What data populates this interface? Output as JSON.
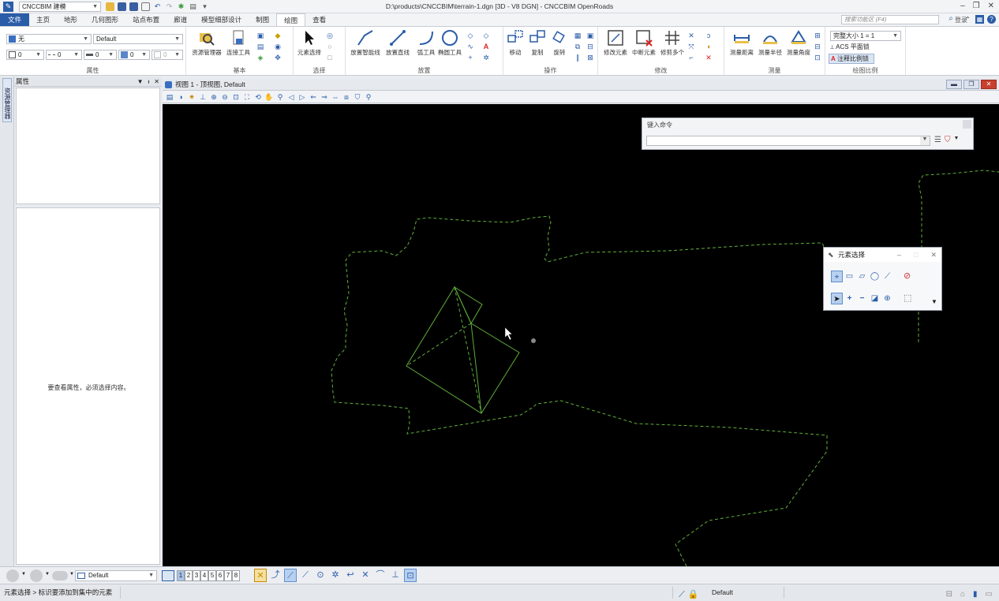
{
  "titlebar": {
    "workspace": "CNCCBIM 建模",
    "doc_title": "D:\\products\\CNCCBIM\\terrain-1.dgn [3D - V8 DGN] - CNCCBIM OpenRoads"
  },
  "ribbon_tabs": [
    "文件",
    "主页",
    "地形",
    "几何图形",
    "站点布置",
    "廊道",
    "模型细部设计",
    "制图",
    "绘图",
    "查看"
  ],
  "active_tab_index": 8,
  "search": {
    "placeholder": "搜索功能区 (F4)"
  },
  "login_label": "登录",
  "attributes_group": {
    "label": "属性",
    "level_value": "无",
    "style_value": "Default",
    "color_value": "0",
    "weight_value": "0",
    "linestyle_value": "0",
    "transparency_value": "0",
    "priority_value": "0"
  },
  "basic_group": {
    "label": "基本",
    "resource_manager": "资源管理器",
    "attach_tools": "连接工具"
  },
  "select_group": {
    "label": "选择",
    "element_selection": "元素选择"
  },
  "place_group": {
    "label": "放置",
    "smartline": "放置智能线",
    "place_line": "放置直线",
    "arc_tools": "弧工具",
    "ellipse_tools": "椭圆工具"
  },
  "operate_group": {
    "label": "操作",
    "move": "移动",
    "copy": "复制",
    "rotate": "旋转"
  },
  "modify_group": {
    "label": "修改",
    "modify_element": "修改元素",
    "break_element": "中断元素",
    "trim_multiple": "修剪多个"
  },
  "measure_group": {
    "label": "测量",
    "distance": "测量距离",
    "radius": "测量半径",
    "angle": "测量角度"
  },
  "drawing_scale_group": {
    "label": "绘图比例",
    "scale_value": "完整大小 1 = 1",
    "acs_plane": "ACS 平面锁",
    "annotation_scale": "注释比例锁"
  },
  "properties_panel": {
    "title": "属性",
    "side_tab": "资源管理器",
    "empty_message": "要查看属性，必须选择内容。"
  },
  "view": {
    "title": "视图 1 - 顶视图, Default"
  },
  "keyin": {
    "title": "键入命令",
    "value": ""
  },
  "element_selection_dialog": {
    "title": "元素选择"
  },
  "bottom_bar": {
    "level_value": "Default",
    "view_numbers": [
      "1",
      "2",
      "3",
      "4",
      "5",
      "6",
      "7",
      "8"
    ],
    "active_view": "1"
  },
  "status_bar": {
    "message": "元素选择 > 标识要添加到集中的元素",
    "active_level": "Default"
  },
  "colors": {
    "accent": "#2a5da8",
    "canvas_bg": "#000000",
    "terrain_line": "#5fae3a"
  }
}
